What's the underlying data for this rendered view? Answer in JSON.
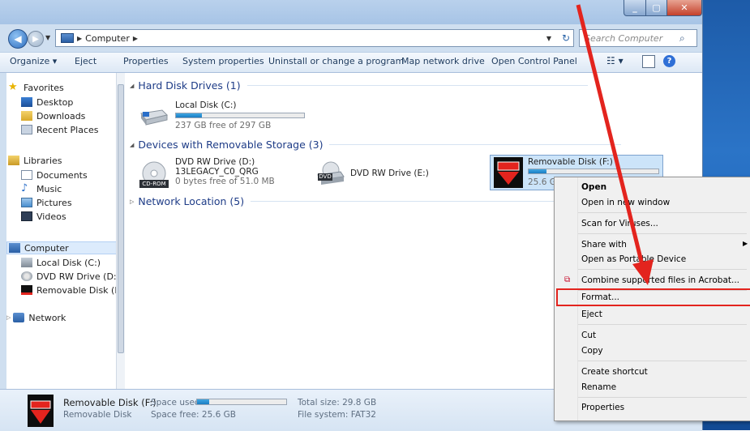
{
  "window": {
    "min_glyph": "_",
    "max_glyph": "▢",
    "close_glyph": "✕"
  },
  "address": {
    "location": "Computer",
    "search_placeholder": "Search Computer"
  },
  "toolbar": {
    "organize": "Organize ▾",
    "eject": "Eject",
    "properties": "Properties",
    "system_properties": "System properties",
    "uninstall": "Uninstall or change a program",
    "map_drive": "Map network drive",
    "control_panel": "Open Control Panel"
  },
  "nav": {
    "favorites": "Favorites",
    "desktop": "Desktop",
    "downloads": "Downloads",
    "recent": "Recent Places",
    "libraries": "Libraries",
    "documents": "Documents",
    "music": "Music",
    "pictures": "Pictures",
    "videos": "Videos",
    "computer": "Computer",
    "local_disk": "Local Disk (C:)",
    "dvd": "DVD RW Drive (D:)",
    "removable": "Removable Disk (F:)",
    "network": "Network"
  },
  "content": {
    "hdd_header": "Hard Disk Drives (1)",
    "local_disk_name": "Local Disk (C:)",
    "local_disk_free": "237 GB free of 297 GB",
    "local_disk_used_fraction": 0.2,
    "removable_header": "Devices with Removable Storage (3)",
    "dvd_d_name": "DVD RW Drive (D:)",
    "dvd_d_label": "13LEGACY_C0_QRG",
    "dvd_d_free": "0 bytes free of 51.0 MB",
    "cdrom_badge": "CD-ROM",
    "dvd_e_name": "DVD RW Drive (E:)",
    "dvd_badge": "DVD",
    "removable_name": "Removable Disk (F:)",
    "removable_free": "25.6 GB",
    "removable_used_fraction": 0.14,
    "network_header": "Network Location (5)"
  },
  "details": {
    "name": "Removable Disk (F:)",
    "space_used_label": "Space used:",
    "type": "Removable Disk",
    "space_free": "Space free: 25.6 GB",
    "total_size": "Total size: 29.8 GB",
    "file_system": "File system: FAT32",
    "used_fraction": 0.14
  },
  "context_menu": {
    "open": "Open",
    "open_new_window": "Open in new window",
    "scan": "Scan for Viruses...",
    "share_with": "Share with",
    "open_portable": "Open as Portable Device",
    "combine": "Combine supported files in Acrobat...",
    "format": "Format...",
    "eject": "Eject",
    "cut": "Cut",
    "copy": "Copy",
    "create_shortcut": "Create shortcut",
    "rename": "Rename",
    "properties": "Properties"
  },
  "colors": {
    "annotation_arrow": "#e3241e",
    "accent": "#1e3c87"
  }
}
